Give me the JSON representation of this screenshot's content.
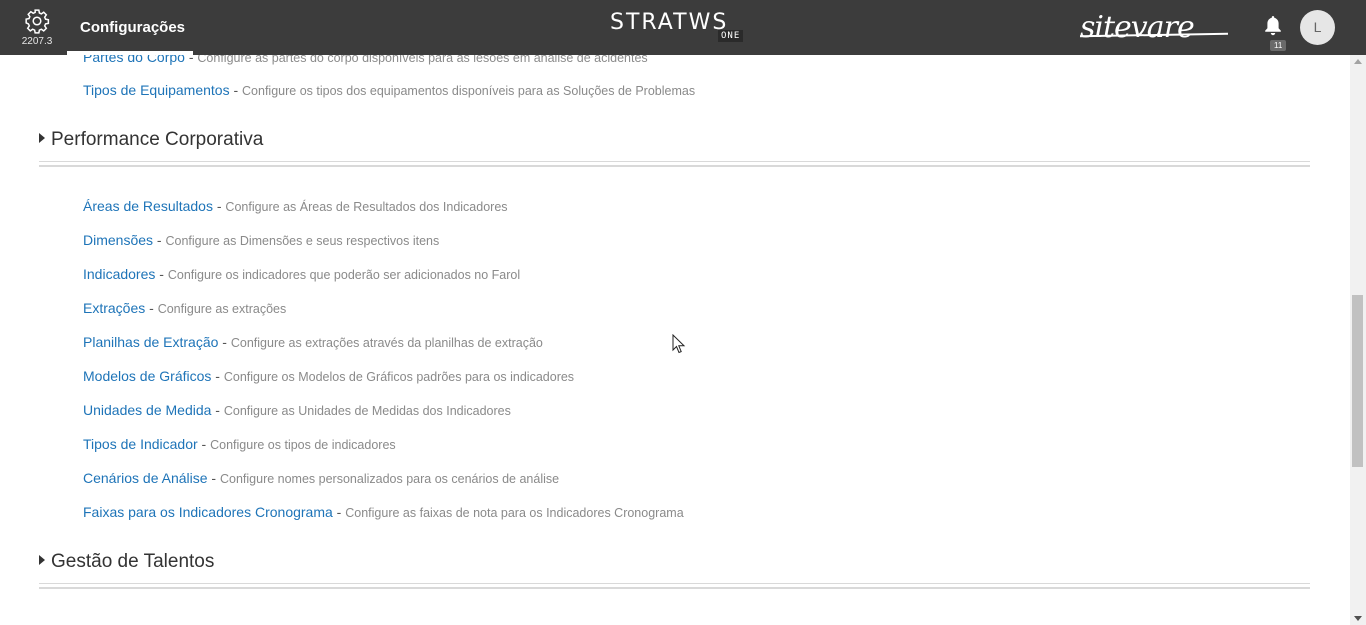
{
  "header": {
    "version": "2207.3",
    "title": "Configurações",
    "brand": "STRATWS",
    "brand_suffix": "ONE",
    "partner_logo": "sitevare",
    "notification_count": "11",
    "avatar_initial": "L"
  },
  "top_links": [
    {
      "label": "Partes do Corpo",
      "sep": " - ",
      "desc": "Configure as partes do corpo disponíveis para as lesões em análise de acidentes"
    },
    {
      "label": "Tipos de Equipamentos",
      "sep": " - ",
      "desc": "Configure os tipos dos equipamentos disponíveis para as Soluções de Problemas"
    }
  ],
  "sections": [
    {
      "title": "Performance Corporativa",
      "items": [
        {
          "label": "Áreas de Resultados",
          "sep": " - ",
          "desc": "Configure as Áreas de Resultados dos Indicadores"
        },
        {
          "label": "Dimensões",
          "sep": " - ",
          "desc": "Configure as Dimensões e seus respectivos itens"
        },
        {
          "label": "Indicadores",
          "sep": " - ",
          "desc": "Configure os indicadores que poderão ser adicionados no Farol"
        },
        {
          "label": "Extrações",
          "sep": " - ",
          "desc": "Configure as extrações"
        },
        {
          "label": "Planilhas de Extração",
          "sep": " - ",
          "desc": "Configure as extrações através da planilhas de extração"
        },
        {
          "label": "Modelos de Gráficos",
          "sep": " - ",
          "desc": "Configure os Modelos de Gráficos padrões para os indicadores"
        },
        {
          "label": "Unidades de Medida",
          "sep": " - ",
          "desc": "Configure as Unidades de Medidas dos Indicadores"
        },
        {
          "label": "Tipos de Indicador",
          "sep": " - ",
          "desc": "Configure os tipos de indicadores"
        },
        {
          "label": "Cenários de Análise",
          "sep": " - ",
          "desc": "Configure nomes personalizados para os cenários de análise"
        },
        {
          "label": "Faixas para os Indicadores Cronograma",
          "sep": " - ",
          "desc": "Configure as faixas de nota para os Indicadores Cronograma"
        }
      ]
    },
    {
      "title": "Gestão de Talentos",
      "items": []
    }
  ],
  "icons": {
    "settings": "gear-icon",
    "notifications": "bell-icon",
    "section_toggle": "caret-right-icon"
  },
  "colors": {
    "topbar": "#3c3c3c",
    "link": "#1e74b8",
    "description": "#8a8a8a"
  }
}
